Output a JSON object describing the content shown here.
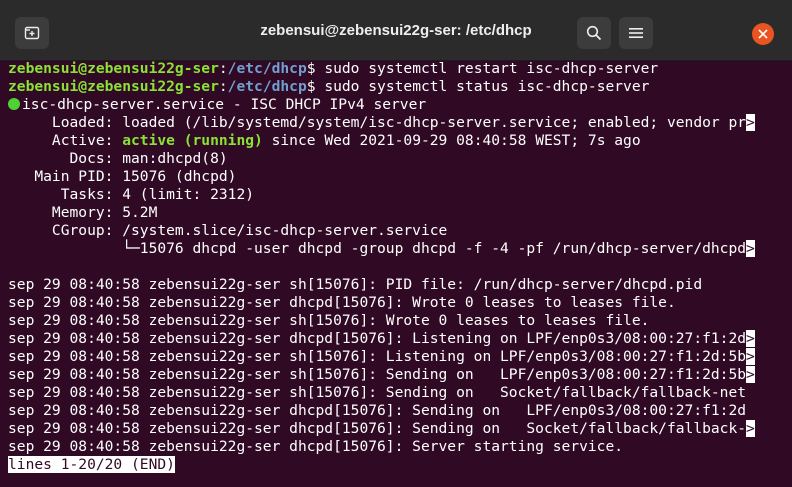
{
  "window": {
    "title": "zebensui@zebensui22g-ser: /etc/dhcp"
  },
  "colors": {
    "background": "#300a24",
    "prompt_green": "#8ae234",
    "path_blue": "#729fcf",
    "active_dot": "#4fd034",
    "close_button": "#e95420"
  },
  "icons": {
    "new_tab": "new-tab-icon",
    "search": "search-icon",
    "menu": "hamburger-menu-icon",
    "close": "close-icon"
  },
  "terminal": {
    "cmd1": {
      "user": "zebensui@zebensui22g-ser",
      "sep": ":",
      "path": "/etc/dhcp",
      "dollar": "$ ",
      "command": "sudo systemctl restart isc-dhcp-server"
    },
    "cmd2": {
      "user": "zebensui@zebensui22g-ser",
      "sep": ":",
      "path": "/etc/dhcp",
      "dollar": "$ ",
      "command": "sudo systemctl status isc-dhcp-server"
    },
    "service_line": "isc-dhcp-server.service - ISC DHCP IPv4 server",
    "loaded": "     Loaded: loaded (/lib/systemd/system/isc-dhcp-server.service; enabled; vendor pr",
    "active_label": "     Active: ",
    "active_state": "active (running)",
    "active_rest": " since Wed 2021-09-29 08:40:58 WEST; 7s ago",
    "docs": "       Docs: man:dhcpd(8)",
    "main_pid": "   Main PID: 15076 (dhcpd)",
    "tasks": "      Tasks: 4 (limit: 2312)",
    "memory": "     Memory: 5.2M",
    "cgroup": "     CGroup: /system.slice/isc-dhcp-server.service",
    "cgroup_child": "             └─15076 dhcpd -user dhcpd -group dhcpd -f -4 -pf /run/dhcp-server/dhcpd",
    "truncation_marker": ">",
    "logs": [
      "sep 29 08:40:58 zebensui22g-ser sh[15076]: PID file: /run/dhcp-server/dhcpd.pid",
      "sep 29 08:40:58 zebensui22g-ser dhcpd[15076]: Wrote 0 leases to leases file.",
      "sep 29 08:40:58 zebensui22g-ser sh[15076]: Wrote 0 leases to leases file.",
      "sep 29 08:40:58 zebensui22g-ser dhcpd[15076]: Listening on LPF/enp0s3/08:00:27:f1:2d",
      "sep 29 08:40:58 zebensui22g-ser sh[15076]: Listening on LPF/enp0s3/08:00:27:f1:2d:5b",
      "sep 29 08:40:58 zebensui22g-ser sh[15076]: Sending on   LPF/enp0s3/08:00:27:f1:2d:5b",
      "sep 29 08:40:58 zebensui22g-ser sh[15076]: Sending on   Socket/fallback/fallback-net",
      "sep 29 08:40:58 zebensui22g-ser dhcpd[15076]: Sending on   LPF/enp0s3/08:00:27:f1:2d",
      "sep 29 08:40:58 zebensui22g-ser dhcpd[15076]: Sending on   Socket/fallback/fallback-",
      "sep 29 08:40:58 zebensui22g-ser dhcpd[15076]: Server starting service."
    ],
    "pager_status": "lines 1-20/20 (END)"
  }
}
